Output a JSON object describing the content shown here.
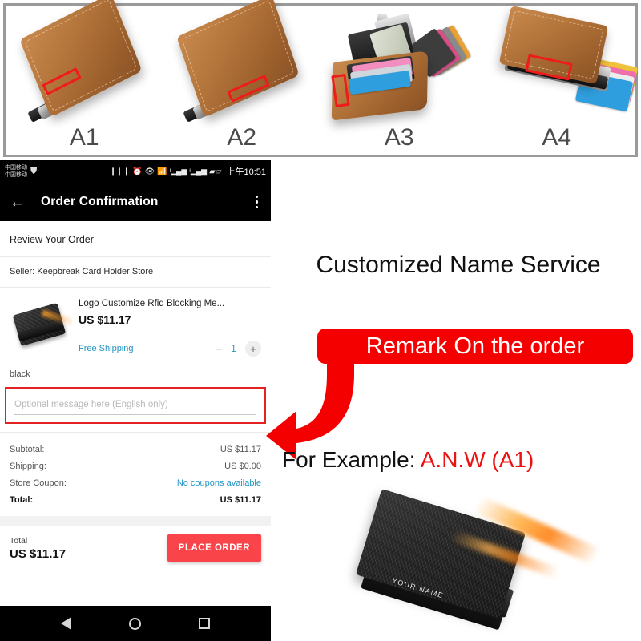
{
  "variants": {
    "items": [
      {
        "code": "A1",
        "name": "brown-wallet-closed-front"
      },
      {
        "code": "A2",
        "name": "brown-wallet-closed-angled"
      },
      {
        "code": "A3",
        "name": "brown-wallet-open-cards-cash"
      },
      {
        "code": "A4",
        "name": "brown-wallet-cards-fanned"
      }
    ]
  },
  "phone": {
    "statusbar": {
      "carrier_line1": "中国移动",
      "carrier_line2": "中国移动",
      "time": "上午10:51",
      "icons": [
        "vibrate-icon",
        "alarm-icon",
        "eye-icon",
        "wifi-icon",
        "signal-icon",
        "signal-icon",
        "battery-icon"
      ]
    },
    "appbar": {
      "title": "Order Confirmation",
      "back_label": "←",
      "menu_label": "⋮"
    },
    "section_title": "Review Your Order",
    "seller": "Seller: Keepbreak Card Holder Store",
    "product": {
      "name": "Logo Customize Rfid Blocking Me...",
      "price": "US $11.17",
      "shipping": "Free Shipping",
      "quantity": "1",
      "minus_label": "–",
      "plus_label": "+",
      "variant": "black"
    },
    "message": {
      "placeholder": "Optional message here (English only)",
      "value": ""
    },
    "summary": {
      "rows": [
        {
          "key": "Subtotal:",
          "value": "US $11.17",
          "style": "plain"
        },
        {
          "key": "Shipping:",
          "value": "US $0.00",
          "style": "plain"
        },
        {
          "key": "Store Coupon:",
          "value": "No coupons available",
          "style": "link"
        },
        {
          "key": "Total:",
          "value": "US $11.17",
          "style": "total"
        }
      ]
    },
    "checkout": {
      "total_label": "Total",
      "total_value": "US $11.17",
      "button_label": "PLACE ORDER"
    },
    "navbar": {
      "back": "nav-back-icon",
      "home": "nav-home-icon",
      "recents": "nav-recents-icon"
    }
  },
  "marketing": {
    "headline": "Customized Name Service",
    "banner": "Remark On the order",
    "example_prefix": "For Example: ",
    "example_value": "A.N.W (A1)",
    "engraving": "YOUR NAME"
  },
  "colors": {
    "banner_red": "#f40000",
    "highlight_red": "#ee1111",
    "place_order_red": "#f9444a",
    "link_blue": "#2196c4",
    "panel_border": "#9a9a9a"
  }
}
